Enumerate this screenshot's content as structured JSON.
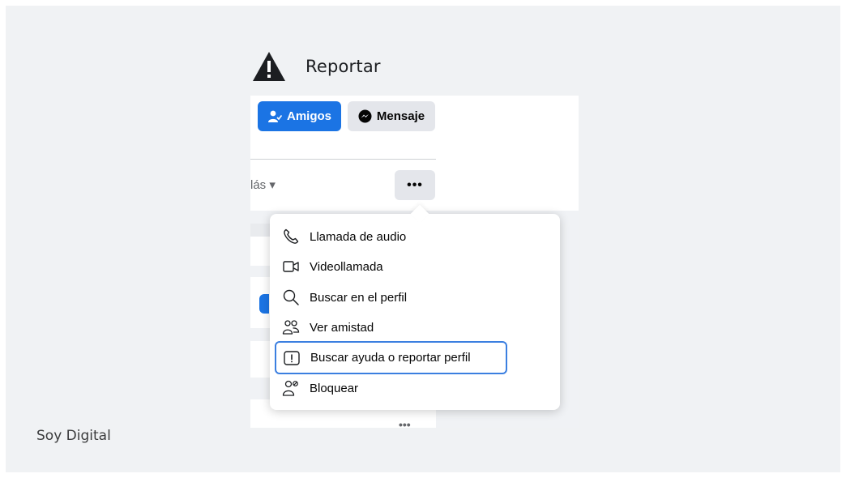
{
  "slide": {
    "title": "Reportar",
    "brand": "Soy Digital"
  },
  "profile": {
    "friends_button": "Amigos",
    "message_button": "Mensaje",
    "more_tab": "lás ▾",
    "dots_button": "•••",
    "card_dots": "•••"
  },
  "menu": {
    "items": [
      {
        "label": "Llamada de audio",
        "icon": "phone-icon"
      },
      {
        "label": "Videollamada",
        "icon": "video-camera-icon"
      },
      {
        "label": "Buscar en el perfil",
        "icon": "search-icon"
      },
      {
        "label": "Ver amistad",
        "icon": "friendship-icon"
      },
      {
        "label": "Buscar ayuda o reportar perfil",
        "icon": "report-icon"
      },
      {
        "label": "Bloquear",
        "icon": "block-user-icon"
      }
    ]
  },
  "colors": {
    "accent": "#1b74e4",
    "highlight_border": "#3b7fe0",
    "background": "#f0f2f4"
  }
}
